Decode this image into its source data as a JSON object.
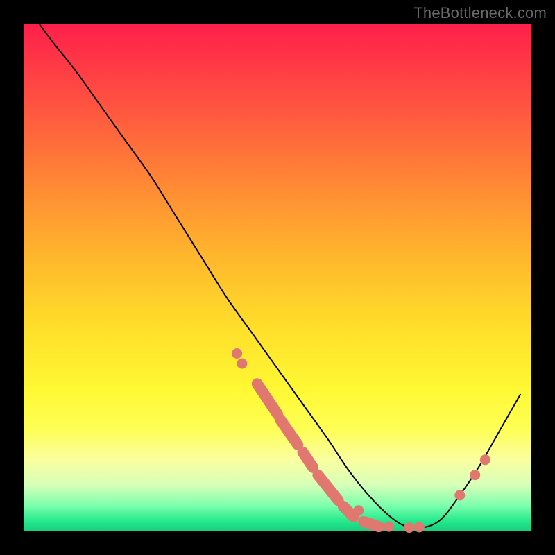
{
  "watermark": "TheBottleneck.com",
  "chart_data": {
    "type": "line",
    "title": "",
    "xlabel": "",
    "ylabel": "",
    "xlim": [
      0,
      100
    ],
    "ylim": [
      0,
      100
    ],
    "background": "gradient-red-yellow-green",
    "series": [
      {
        "name": "bottleneck-curve",
        "x": [
          3,
          6,
          10,
          15,
          20,
          25,
          30,
          35,
          40,
          45,
          50,
          55,
          60,
          64,
          68,
          72,
          75,
          78,
          82,
          86,
          90,
          94,
          98
        ],
        "y": [
          100,
          96,
          91,
          84,
          77,
          70,
          62,
          54,
          46,
          39,
          32,
          25,
          18,
          12,
          7,
          3,
          1,
          0.5,
          2,
          7,
          13,
          20,
          27
        ]
      }
    ],
    "markers": {
      "dots": [
        {
          "x": 42,
          "y": 35
        },
        {
          "x": 43,
          "y": 33
        },
        {
          "x": 66,
          "y": 4
        },
        {
          "x": 72,
          "y": 0.8
        },
        {
          "x": 76,
          "y": 0.6
        },
        {
          "x": 78,
          "y": 0.7
        },
        {
          "x": 86,
          "y": 7
        },
        {
          "x": 89,
          "y": 11
        },
        {
          "x": 91,
          "y": 14
        }
      ],
      "pills": [
        {
          "x1": 46,
          "y1": 29,
          "x2": 50,
          "y2": 23
        },
        {
          "x1": 50.5,
          "y1": 22,
          "x2": 54,
          "y2": 17
        },
        {
          "x1": 55,
          "y1": 15.5,
          "x2": 57,
          "y2": 12.5
        },
        {
          "x1": 58,
          "y1": 11,
          "x2": 62,
          "y2": 6
        },
        {
          "x1": 63,
          "y1": 4.8,
          "x2": 65,
          "y2": 2.8
        },
        {
          "x1": 67,
          "y1": 1.8,
          "x2": 70,
          "y2": 0.8
        }
      ]
    }
  }
}
